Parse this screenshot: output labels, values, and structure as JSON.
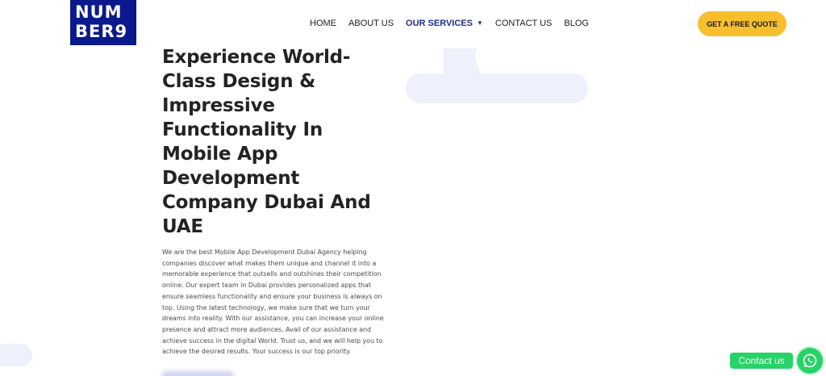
{
  "header": {
    "logo_line1": "NUM",
    "logo_line2": "BER9",
    "nav": [
      {
        "label": "HOME"
      },
      {
        "label": "ABOUT US"
      },
      {
        "label": "OUR SERVICES",
        "active": true
      },
      {
        "label": "CONTACT US"
      },
      {
        "label": "BLOG"
      }
    ],
    "cta_label": "GET A FREE QUOTE"
  },
  "hero": {
    "title": "Experience World-Class Design & Impressive Functionality In Mobile App Development Company Dubai And UAE",
    "body": "We are the best Mobile App Development Dubai Agency helping companies discover what makes them unique and channel it into a memorable experience that outsells and outshines their competition online. Our expert team in Dubai provides personalized apps that ensure seamless functionality and ensure your business is always on top. Using the latest technology, we make sure that we turn your dreams into reality. With our assistance, you can increase your online presence and attract more audiences. Avail of our assistance and achieve success in the digital World. Trust us, and we will help you to achieve the desired results. Your success is our top priority."
  },
  "contact_widget": {
    "label": "Contact us",
    "icon": "whatsapp-icon"
  },
  "colors": {
    "brand": "#0a1a8c",
    "cta": "#f7bf2c",
    "active_nav": "#1e2f8a",
    "whatsapp": "#25d366"
  }
}
